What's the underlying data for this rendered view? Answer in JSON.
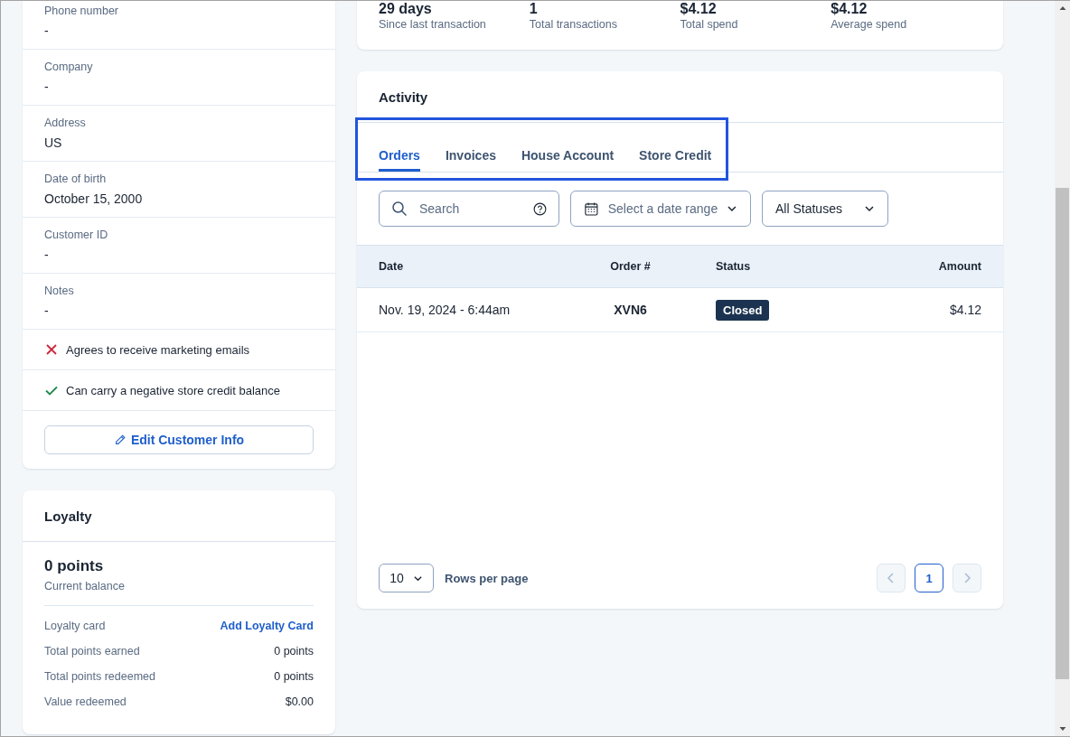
{
  "stats": [
    {
      "value": "29 days",
      "label": "Since last transaction"
    },
    {
      "value": "1",
      "label": "Total transactions"
    },
    {
      "value": "$4.12",
      "label": "Total spend"
    },
    {
      "value": "$4.12",
      "label": "Average spend"
    }
  ],
  "customer_fields": [
    {
      "label": "Phone number",
      "value": "-"
    },
    {
      "label": "Company",
      "value": "-"
    },
    {
      "label": "Address",
      "value": "US"
    },
    {
      "label": "Date of birth",
      "value": "October 15, 2000"
    },
    {
      "label": "Customer ID",
      "value": "-"
    },
    {
      "label": "Notes",
      "value": "-"
    }
  ],
  "flags": [
    {
      "label": "Agrees to receive marketing emails",
      "checked": false
    },
    {
      "label": "Can carry a negative store credit balance",
      "checked": true
    }
  ],
  "edit_button": "Edit Customer Info",
  "loyalty": {
    "title": "Loyalty",
    "points": "0 points",
    "points_label": "Current balance",
    "details": [
      {
        "label": "Loyalty card",
        "value": "Add Loyalty Card",
        "kind": "link"
      },
      {
        "label": "Total points earned",
        "value": "0 points",
        "kind": "text"
      },
      {
        "label": "Total points redeemed",
        "value": "0 points",
        "kind": "text"
      },
      {
        "label": "Value redeemed",
        "value": "$0.00",
        "kind": "text"
      }
    ]
  },
  "activity": {
    "title": "Activity",
    "tabs_highlighted": true,
    "tabs": [
      {
        "label": "Orders",
        "selected": true
      },
      {
        "label": "Invoices",
        "selected": false
      },
      {
        "label": "House Account",
        "selected": false
      },
      {
        "label": "Store Credit",
        "selected": false
      }
    ],
    "search": {
      "placeholder": "Search"
    },
    "date_filter": {
      "placeholder": "Select a date range"
    },
    "status_filter": {
      "value": "All Statuses"
    },
    "table": {
      "columns": [
        "Date",
        "Order #",
        "Status",
        "Amount"
      ],
      "rows": [
        {
          "date": "Nov. 19, 2024 - 6:44am",
          "order": "XVN6",
          "status": "Closed",
          "amount": "$4.12"
        }
      ]
    },
    "rows_per_page": {
      "value": "10",
      "label": "Rows per page"
    },
    "pagination": {
      "prev_disabled": true,
      "next_disabled": true,
      "pages": [
        {
          "label": "1",
          "selected": true
        }
      ]
    }
  }
}
